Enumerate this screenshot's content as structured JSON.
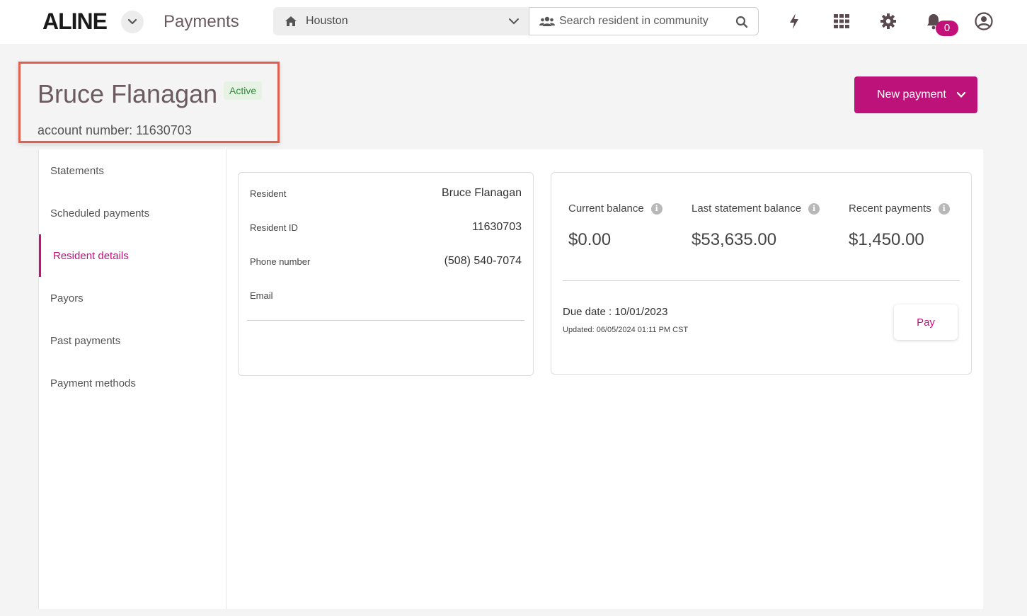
{
  "header": {
    "logo": "ALINE",
    "app_title": "Payments",
    "community": "Houston",
    "search_placeholder": "Search resident in community",
    "notifications_count": "0"
  },
  "resident": {
    "name": "Bruce Flanagan",
    "status": "Active",
    "account_line": "account number: 11630703"
  },
  "actions": {
    "new_payment": "New payment"
  },
  "sidebar": {
    "items": [
      {
        "label": "Statements"
      },
      {
        "label": "Scheduled payments"
      },
      {
        "label": "Resident details"
      },
      {
        "label": "Payors"
      },
      {
        "label": "Past payments"
      },
      {
        "label": "Payment methods"
      }
    ]
  },
  "details": {
    "rows": [
      {
        "label": "Resident",
        "value": "Bruce Flanagan"
      },
      {
        "label": "Resident ID",
        "value": "11630703"
      },
      {
        "label": "Phone number",
        "value": "(508) 540-7074"
      },
      {
        "label": "Email",
        "value": ""
      }
    ]
  },
  "balance": {
    "current_label": "Current balance",
    "current_value": "$0.00",
    "last_label": "Last statement balance",
    "last_value": "$53,635.00",
    "recent_label": "Recent payments",
    "recent_value": "$1,450.00",
    "due_date": "Due date : 10/01/2023",
    "updated": "Updated: 06/05/2024 01:11 PM CST",
    "pay_label": "Pay"
  },
  "colors": {
    "brand": "#bd1279",
    "active_badge_bg": "#e6f2e4",
    "active_badge_text": "#2f8a3b",
    "highlight_border": "#e0604f"
  }
}
